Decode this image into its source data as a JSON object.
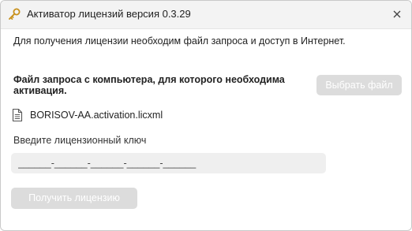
{
  "window": {
    "title": "Активатор лицензий версия 0.3.29",
    "icon": "key-icon",
    "close_icon": "close-icon"
  },
  "main": {
    "info_text": "Для получения лицензии необходим файл запроса и доступ в Интернет.",
    "file_request_label": "Файл запроса с компьютера, для которого необходима активация.",
    "select_file_button": "Выбрать файл",
    "file_icon": "document-icon",
    "file_name": "BORISOV-AA.activation.licxml",
    "license_key_label": "Введите лицензионный ключ",
    "license_key_value": "______-______-______-______-______",
    "get_license_button": "Получить лицензию"
  },
  "colors": {
    "titlebar_bg": "#f3f3f3",
    "disabled_button_bg": "#dcdcdc",
    "input_bg": "#efefef",
    "key_icon": "#c8901a"
  }
}
